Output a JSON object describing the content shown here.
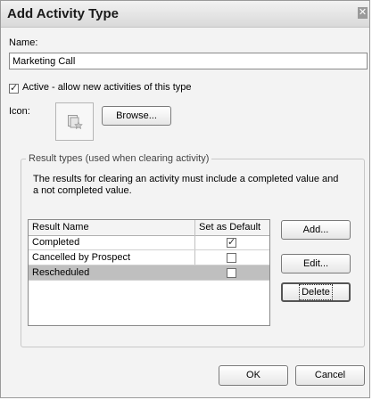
{
  "window": {
    "title": "Add Activity Type",
    "close_glyph": "✕"
  },
  "name_field": {
    "label": "Name:",
    "value": "Marketing Call"
  },
  "active": {
    "label": "Active - allow new activities of this type",
    "checked": true
  },
  "icon_section": {
    "label": "Icon:",
    "icon": "activity-type-icon",
    "browse_label": "Browse..."
  },
  "result_types": {
    "legend": "Result types (used when clearing activity)",
    "description": "The results for clearing an activity must include a completed value and a not completed value.",
    "columns": [
      "Result Name",
      "Set as Default"
    ],
    "rows": [
      {
        "name": "Completed",
        "default": true,
        "selected": false
      },
      {
        "name": "Cancelled by Prospect",
        "default": false,
        "selected": false
      },
      {
        "name": "Rescheduled",
        "default": false,
        "selected": true
      }
    ],
    "add_label": "Add...",
    "edit_label": "Edit...",
    "delete_label": "Delete"
  },
  "footer": {
    "ok_label": "OK",
    "cancel_label": "Cancel"
  },
  "colors": {
    "selected_row": "#bfbfbf",
    "window_bg": "#f3f3f3"
  }
}
